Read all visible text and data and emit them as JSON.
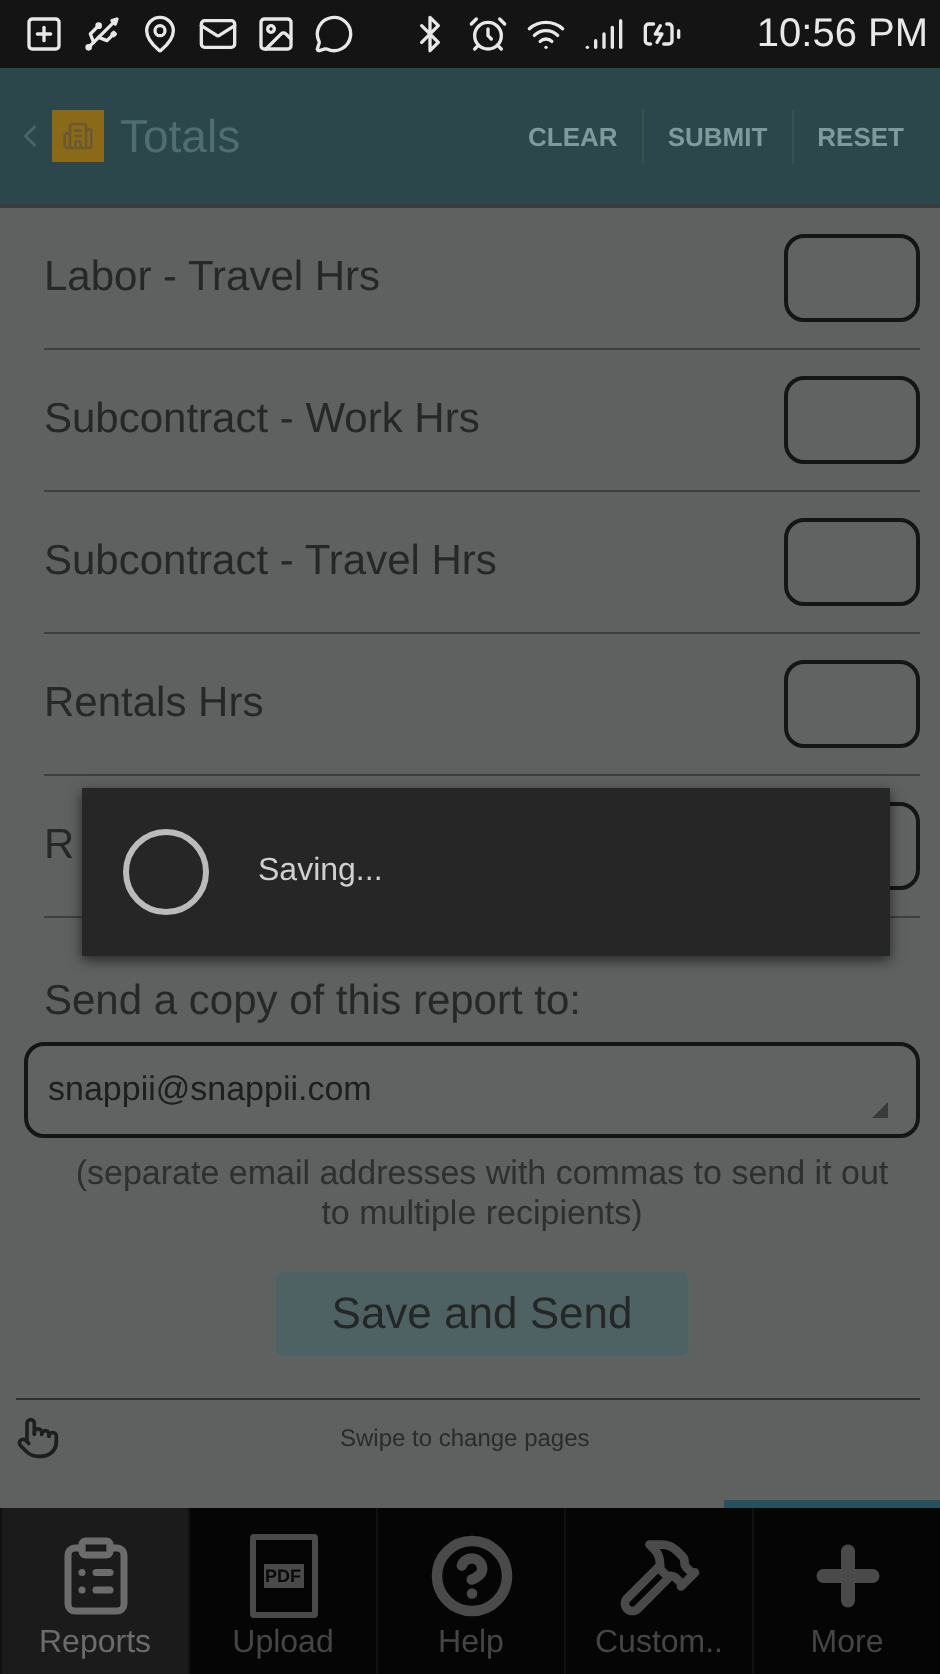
{
  "status_bar": {
    "time": "10:56 PM"
  },
  "action_bar": {
    "title": "Totals",
    "actions": [
      "CLEAR",
      "SUBMIT",
      "RESET"
    ]
  },
  "rows": [
    {
      "label": "Labor - Travel Hrs"
    },
    {
      "label": "Subcontract - Work Hrs"
    },
    {
      "label": "Subcontract - Travel Hrs"
    },
    {
      "label": "Rentals Hrs"
    },
    {
      "label": "R"
    }
  ],
  "email": {
    "label": "Send a copy of this report to:",
    "value": "snappii@snappii.com",
    "note": "(separate email addresses with commas to send it out to multiple recipients)"
  },
  "save_button": "Save and Send",
  "swipe_hint": "Swipe to change pages",
  "dialog": {
    "message": "Saving..."
  },
  "nav": [
    {
      "label": "Reports",
      "kind": "clipboard",
      "selected": true
    },
    {
      "label": "Upload",
      "kind": "pdf",
      "badge": "PDF",
      "selected": false
    },
    {
      "label": "Help",
      "kind": "help",
      "selected": false
    },
    {
      "label": "Custom..",
      "kind": "tools",
      "selected": false
    },
    {
      "label": "More",
      "kind": "plus",
      "selected": false
    }
  ]
}
